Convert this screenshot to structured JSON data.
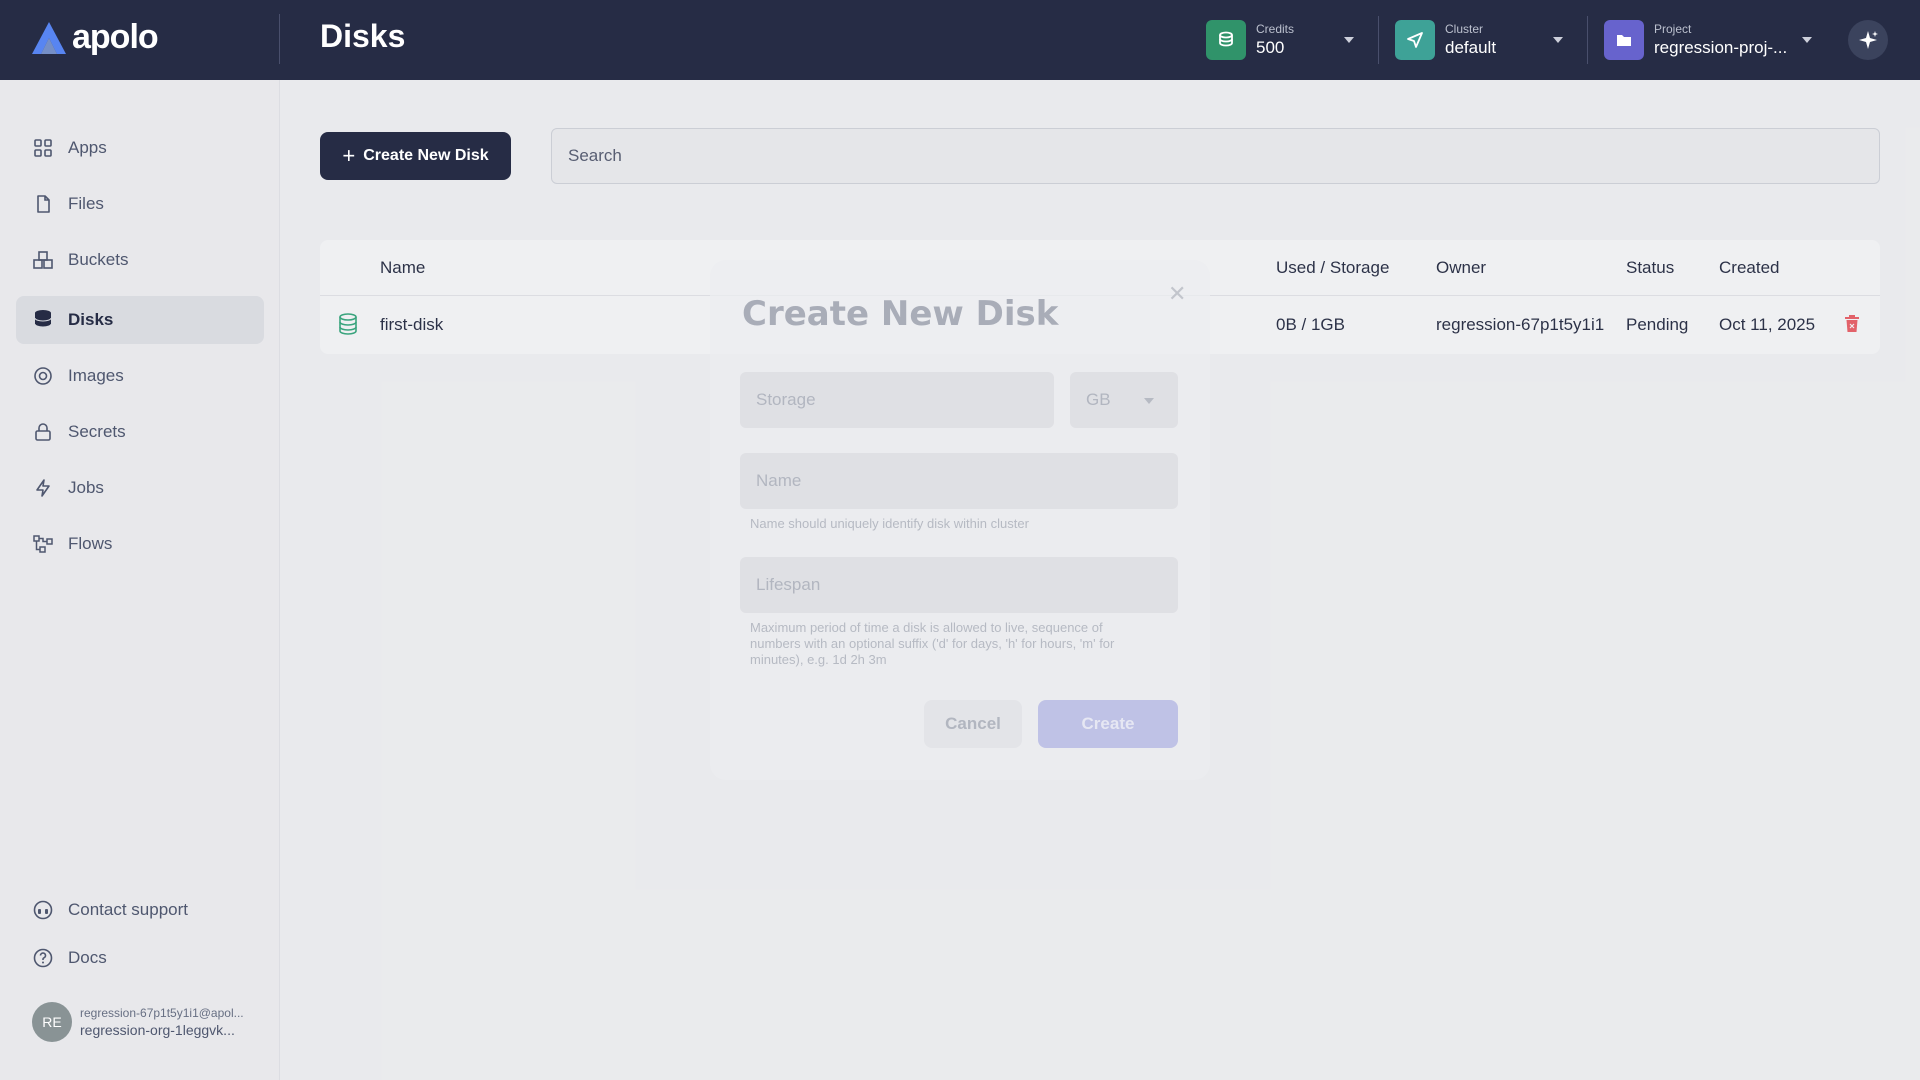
{
  "header": {
    "logo_text": "apolo",
    "page_title": "Disks",
    "credits": {
      "label": "Credits",
      "value": "500",
      "icon": "coins-icon",
      "color": "#1f8a5e"
    },
    "cluster": {
      "label": "Cluster",
      "value": "default",
      "icon": "send-icon",
      "color": "#2e9b8f"
    },
    "project": {
      "label": "Project",
      "value": "regression-proj-...",
      "icon": "folder-icon",
      "color": "#5b56c9"
    },
    "ai_icon": "sparkle-icon"
  },
  "sidebar": {
    "items": [
      {
        "id": "apps",
        "label": "Apps",
        "icon": "grid-icon",
        "active": false
      },
      {
        "id": "files",
        "label": "Files",
        "icon": "file-icon",
        "active": false
      },
      {
        "id": "buckets",
        "label": "Buckets",
        "icon": "buckets-icon",
        "active": false
      },
      {
        "id": "disks",
        "label": "Disks",
        "icon": "database-icon",
        "active": true
      },
      {
        "id": "images",
        "label": "Images",
        "icon": "image-disc-icon",
        "active": false
      },
      {
        "id": "secrets",
        "label": "Secrets",
        "icon": "lock-icon",
        "active": false
      },
      {
        "id": "jobs",
        "label": "Jobs",
        "icon": "lightning-icon",
        "active": false
      },
      {
        "id": "flows",
        "label": "Flows",
        "icon": "flow-icon",
        "active": false
      }
    ],
    "bottom": [
      {
        "id": "support",
        "label": "Contact support",
        "icon": "headset-icon"
      },
      {
        "id": "docs",
        "label": "Docs",
        "icon": "help-circle-icon"
      }
    ],
    "user": {
      "initials": "RE",
      "email": "regression-67p1t5y1i1@apol...",
      "org": "regression-org-1leggvk..."
    }
  },
  "main": {
    "create_button_label": "Create New Disk",
    "search_placeholder": "Search",
    "table": {
      "columns": [
        "Name",
        "Used / Storage",
        "Owner",
        "Status",
        "Created"
      ],
      "rows": [
        {
          "name": "first-disk",
          "usage": "0B / 1GB",
          "owner": "regression-67p1t5y1i1",
          "status": "Pending",
          "created": "Oct 11, 2025"
        }
      ]
    }
  },
  "modal": {
    "title": "Create New Disk",
    "storage_placeholder": "Storage",
    "unit_value": "GB",
    "name_placeholder": "Name",
    "name_helper": "Name should uniquely identify disk within cluster",
    "lifespan_placeholder": "Lifespan",
    "lifespan_helper_1": "Maximum period of time a disk is allowed to live, sequence of",
    "lifespan_helper_2": "numbers with an optional suffix ('d' for days, 'h' for hours, 'm' for",
    "lifespan_helper_3": "minutes), e.g. 1d 2h 3m",
    "cancel_label": "Cancel",
    "create_label": "Create"
  }
}
